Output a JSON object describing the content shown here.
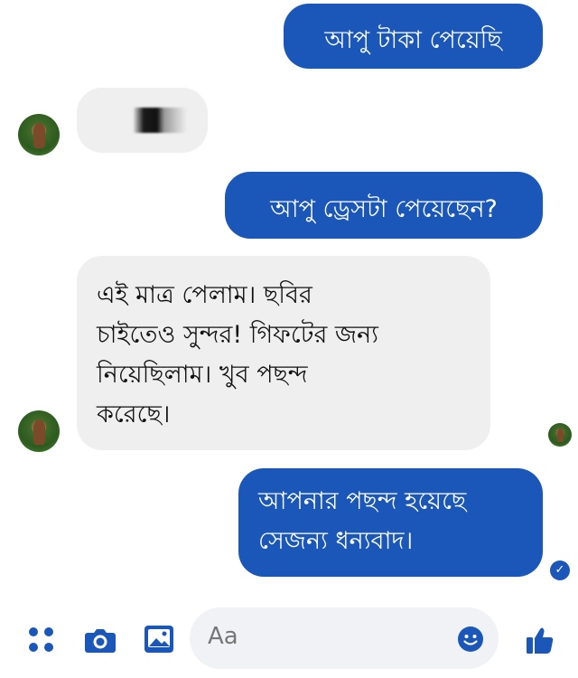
{
  "colors": {
    "accent": "#1a57b8",
    "outgoing_bubble": "#1a57b8",
    "incoming_bubble": "#efefef",
    "composer_bg": "#f0f2f5"
  },
  "messages": [
    {
      "direction": "outgoing",
      "lines": [
        "আপু টাকা পেয়েছি"
      ]
    },
    {
      "direction": "incoming",
      "lines": []
    },
    {
      "direction": "outgoing",
      "lines": [
        "আপু ড্রেসটা পেয়েছেন?"
      ]
    },
    {
      "direction": "incoming",
      "lines": [
        "এই মাত্র পেলাম। ছবির",
        "চাইতেও সুন্দর! গিফটের জন্য",
        "নিয়েছিলাম। খুব পছন্দ",
        "করেছে।"
      ]
    },
    {
      "direction": "outgoing",
      "lines": [
        "আপনার পছন্দ হয়েছে",
        "সেজন্য ধন্যবাদ।"
      ]
    }
  ],
  "status": {
    "seen_icon": "check-circle-icon"
  },
  "composer": {
    "placeholder": "Aa",
    "icons": [
      "apps-icon",
      "camera-icon",
      "image-icon",
      "emoji-icon",
      "thumbs-up-icon"
    ]
  }
}
